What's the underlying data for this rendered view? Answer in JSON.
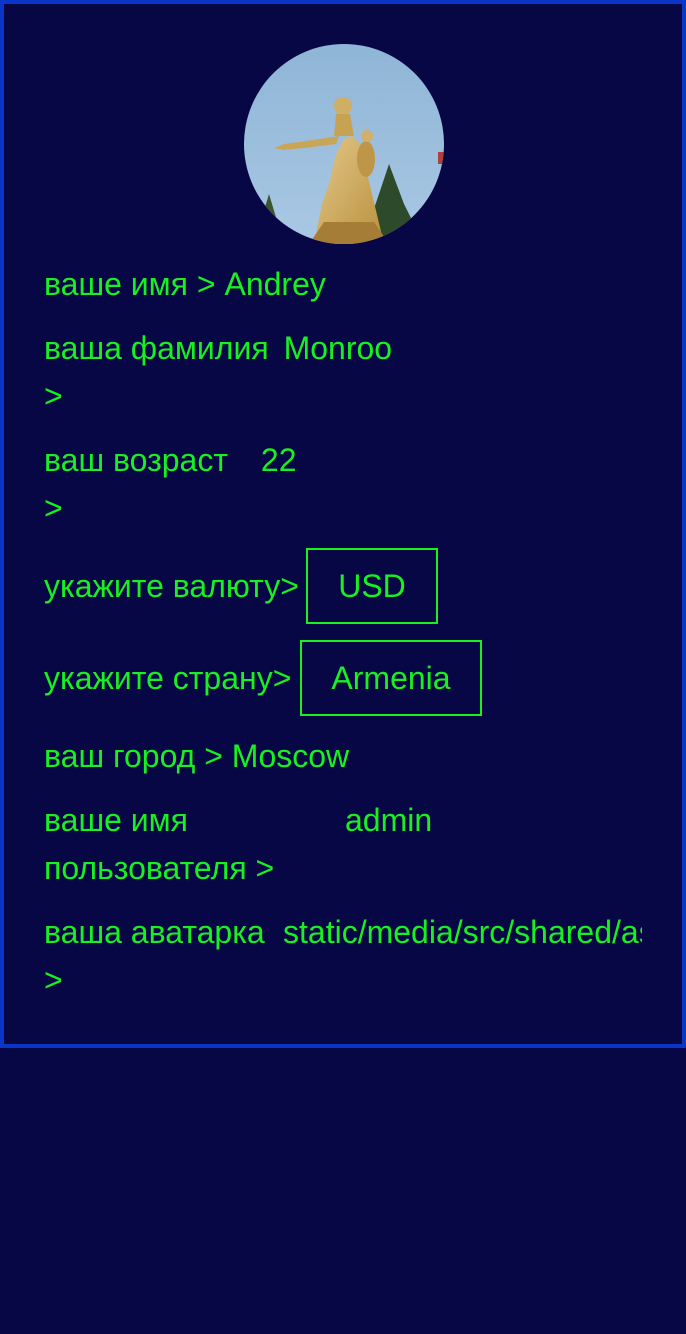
{
  "profile": {
    "avatar_icon": "statue-photo",
    "first_name": {
      "label": "ваше имя >",
      "value": "Andrey"
    },
    "last_name": {
      "label": "ваша фамилия",
      "arrow": ">",
      "value": "Monroo"
    },
    "age": {
      "label": "ваш возраст",
      "arrow": ">",
      "value": "22"
    },
    "currency": {
      "label": "укажите валюту>",
      "value": "USD"
    },
    "country": {
      "label": "укажите страну>",
      "value": "Armenia"
    },
    "city": {
      "label": "ваш город >",
      "value": "Moscow"
    },
    "username": {
      "label_line1": "ваше имя",
      "label_line2": "пользователя >",
      "value": "admin"
    },
    "avatar_path": {
      "label": "ваша аватарка",
      "arrow": ">",
      "value": "static/media/src/shared/assets"
    }
  },
  "colors": {
    "background": "#070746",
    "border": "#0a35c6",
    "text": "#19f01f"
  }
}
